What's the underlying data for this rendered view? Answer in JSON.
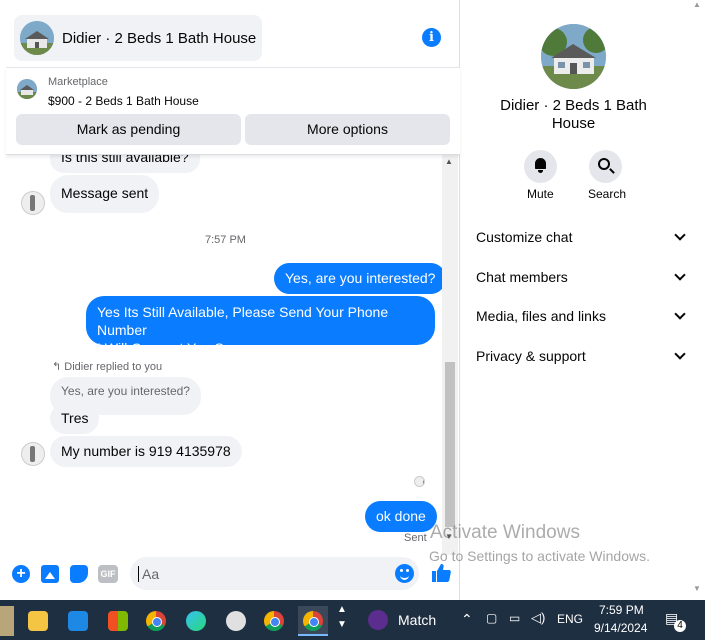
{
  "header": {
    "title": "Didier · 2 Beds 1 Bath House"
  },
  "marketplace": {
    "label": "Marketplace",
    "listing": "$900 - 2 Beds 1 Bath House",
    "pending_button": "Mark as pending",
    "more_button": "More options"
  },
  "messages": {
    "partial_in": "Is this still available?",
    "sent_in": "Message sent",
    "timestamp": "7:57 PM",
    "out1": "Yes, are you interested?",
    "out2_line1": "Yes Its Still Available, Please Send Your Phone Number",
    "out2_line2": "I Will Connect You Soon",
    "replied_label": "Didier replied to you",
    "quoted": "Yes, are you interested?",
    "in_tres": "Tres",
    "in_number": "My number is 919 4135978",
    "out3": "ok done",
    "sent_status": "Sent"
  },
  "composer": {
    "placeholder": "Aa",
    "gif_label": "GIF"
  },
  "info_panel": {
    "name": "Didier · 2 Beds 1 Bath House",
    "mute_label": "Mute",
    "search_label": "Search",
    "menu": [
      "Customize chat",
      "Chat members",
      "Media, files and links",
      "Privacy & support"
    ]
  },
  "watermark": {
    "line1": "Activate Windows",
    "line2": "Go to Settings to activate Windows."
  },
  "taskbar": {
    "widget_label": "Match",
    "lang": "ENG",
    "time": "7:59 PM",
    "date": "9/14/2024",
    "notifications": "4"
  },
  "colors": {
    "accent": "#0a7cff",
    "bubble_in": "#f0f2f5",
    "taskbar": "#1f2f42"
  }
}
